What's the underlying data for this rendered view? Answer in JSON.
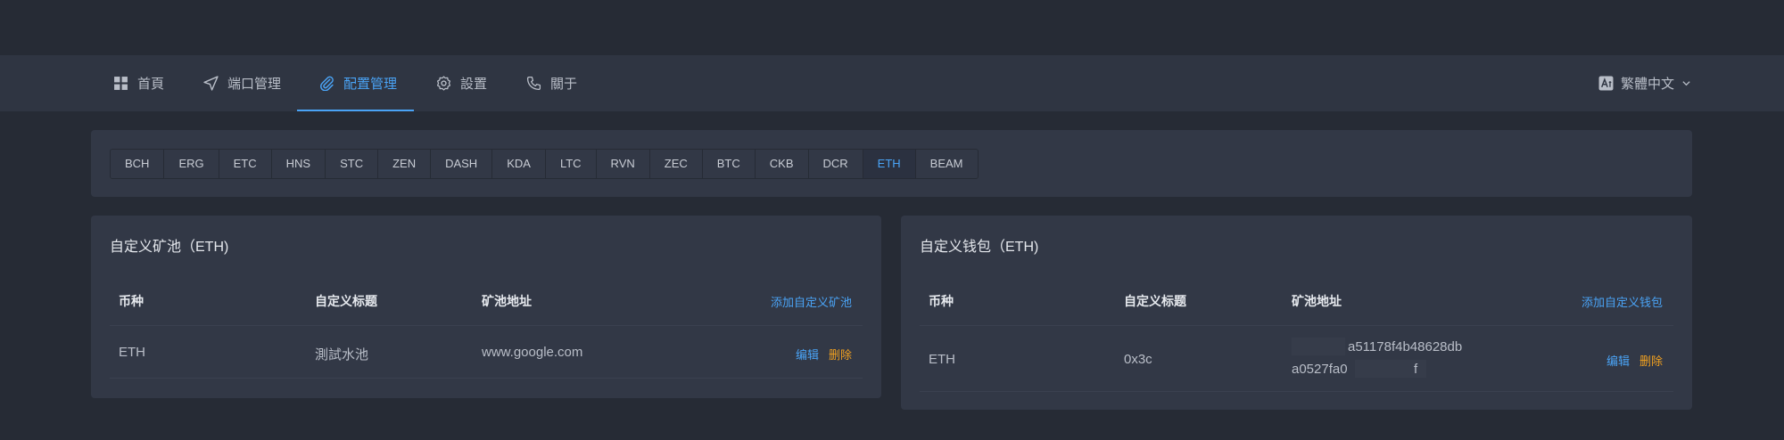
{
  "nav": {
    "items": [
      {
        "label": "首頁",
        "icon": "grid-icon"
      },
      {
        "label": "端口管理",
        "icon": "send-icon"
      },
      {
        "label": "配置管理",
        "icon": "paperclip-icon",
        "active": true
      },
      {
        "label": "設置",
        "icon": "gear-icon"
      },
      {
        "label": "關于",
        "icon": "phone-icon"
      }
    ],
    "language": "繁體中文",
    "accent": "#4aa3f5"
  },
  "coins": [
    "BCH",
    "ERG",
    "ETC",
    "HNS",
    "STC",
    "ZEN",
    "DASH",
    "KDA",
    "LTC",
    "RVN",
    "ZEC",
    "BTC",
    "CKB",
    "DCR",
    "ETH",
    "BEAM"
  ],
  "selected_coin": "ETH",
  "pool_card": {
    "title": "自定义矿池（ETH)",
    "headers": {
      "coin": "币种",
      "title": "自定义标题",
      "address": "矿池地址"
    },
    "add_label": "添加自定义矿池",
    "rows": [
      {
        "coin": "ETH",
        "title": "測試水池",
        "address": "www.google.com",
        "edit": "编辑",
        "delete": "删除"
      }
    ]
  },
  "wallet_card": {
    "title": "自定义钱包（ETH)",
    "headers": {
      "coin": "币种",
      "title": "自定义标题",
      "address": "矿池地址"
    },
    "add_label": "添加自定义钱包",
    "rows": [
      {
        "coin": "ETH",
        "title": "0x3c",
        "address_line1": "a51178f4b48628db",
        "address_line2": "a0527fa0",
        "address_tail": "f",
        "edit": "编辑",
        "delete": "删除"
      }
    ]
  },
  "colors": {
    "edit": "#4aa3f5",
    "delete": "#f0a020"
  }
}
